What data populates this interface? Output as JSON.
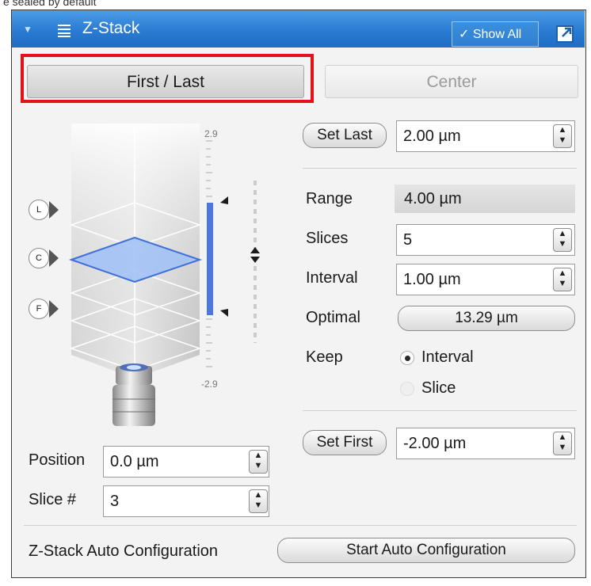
{
  "caption": "e sealed by default",
  "header": {
    "title": "Z-Stack",
    "show_all_label": "Show All",
    "show_all_checked": true
  },
  "tabs": [
    {
      "label": "First / Last",
      "selected": true
    },
    {
      "label": "Center",
      "selected": false
    }
  ],
  "visual": {
    "top_tick": "2.9",
    "bottom_tick": "-2.9",
    "markers": {
      "last": "L",
      "center": "C",
      "first": "F"
    }
  },
  "set_last": {
    "button": "Set Last",
    "value": "2.00 µm"
  },
  "range": {
    "label": "Range",
    "value": "4.00 µm"
  },
  "slices": {
    "label": "Slices",
    "value": "5"
  },
  "interval": {
    "label": "Interval",
    "value": "1.00 µm"
  },
  "optimal": {
    "label": "Optimal",
    "value": "13.29 µm"
  },
  "keep": {
    "label": "Keep",
    "options": [
      {
        "label": "Interval",
        "selected": true,
        "enabled": true
      },
      {
        "label": "Slice",
        "selected": false,
        "enabled": true
      }
    ]
  },
  "set_first": {
    "button": "Set First",
    "value": "-2.00 µm"
  },
  "position": {
    "label": "Position",
    "value": "0.0 µm"
  },
  "slice_num": {
    "label": "Slice #",
    "value": "3"
  },
  "auto_config": {
    "label": "Z-Stack Auto Configuration",
    "button": "Start Auto Configuration"
  },
  "colors": {
    "title_bar": "#2a7bd3",
    "highlight": "#e3121a",
    "slider": "#4a78e0"
  }
}
